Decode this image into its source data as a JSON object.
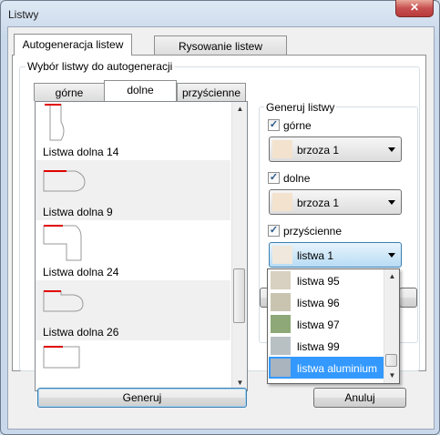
{
  "window": {
    "title": "Listwy",
    "close_glyph": "✕"
  },
  "main_tabs": [
    {
      "label": "Autogeneracja listew",
      "active": true
    },
    {
      "label": "Rysowanie listew",
      "active": false
    }
  ],
  "selection_group": {
    "title": "Wybór listwy do autogeneracji"
  },
  "sub_tabs": [
    {
      "label": "górne",
      "active": false
    },
    {
      "label": "dolne",
      "active": true
    },
    {
      "label": "przyścienne",
      "active": false
    }
  ],
  "list_items": [
    {
      "label": "Listwa dolna 14",
      "icon": "profile-vertical-icon"
    },
    {
      "label": "Listwa dolna 9",
      "icon": "profile-rounded-icon"
    },
    {
      "label": "Listwa dolna 24",
      "icon": "profile-l-icon"
    },
    {
      "label": "Listwa dolna 26",
      "icon": "profile-notched-icon"
    },
    {
      "label": "",
      "icon": "profile-flat-icon"
    }
  ],
  "generate_group": {
    "title": "Generuj listwy",
    "rows": [
      {
        "label": "górne",
        "checked": true,
        "value": "brzoza 1"
      },
      {
        "label": "dolne",
        "checked": true,
        "value": "brzoza 1"
      },
      {
        "label": "przyścienne",
        "checked": true,
        "value": "listwa 1"
      }
    ]
  },
  "dropdown_options": [
    {
      "label": "listwa 95",
      "swatch": "#d8d0c0",
      "selected": false
    },
    {
      "label": "listwa 96",
      "swatch": "#c8c4b0",
      "selected": false
    },
    {
      "label": "listwa 97",
      "swatch": "#8fa878",
      "selected": false
    },
    {
      "label": "listwa 99",
      "swatch": "#b8c0c4",
      "selected": false
    },
    {
      "label": "listwa aluminium",
      "swatch": "#a9b4bf",
      "selected": true
    }
  ],
  "buttons": {
    "generate": "Generuj",
    "cancel": "Anuluj"
  },
  "colors": {
    "accent_red": "#e00000",
    "selection_blue": "#3399ff",
    "hatch": "#9a9a9a"
  }
}
